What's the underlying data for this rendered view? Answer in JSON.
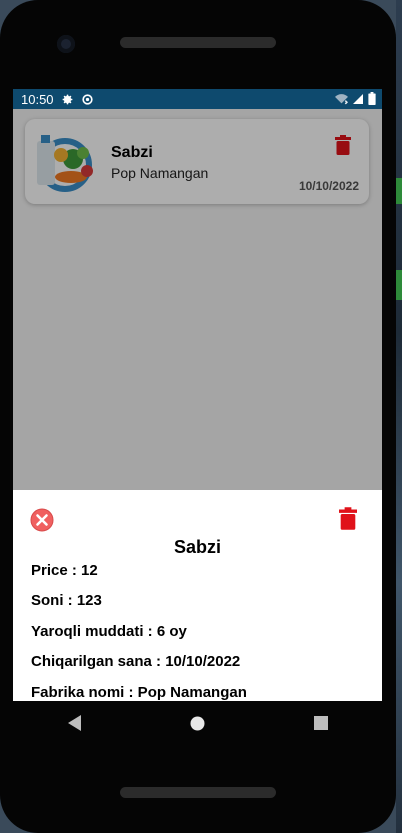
{
  "status": {
    "time": "10:50",
    "icons": [
      "gear-icon",
      "data-saver-icon",
      "wifi-icon",
      "signal-icon",
      "battery-icon"
    ]
  },
  "card": {
    "title": "Sabzi",
    "subtitle": "Pop Namangan",
    "date": "10/10/2022",
    "image": "vegetables-image",
    "trash_icon": "trash-icon"
  },
  "sheet": {
    "title": "Sabzi",
    "rows": {
      "price": "Price : 12",
      "soni": "Soni : 123",
      "muddati": "Yaroqli muddati : 6 oy",
      "sana": "Chiqarilgan sana : 10/10/2022",
      "fabrika": "Fabrika nomi : Pop Namangan"
    },
    "close_icon": "close-circle-icon",
    "trash_icon": "trash-icon"
  },
  "colors": {
    "status_bar": "#0e4a6e",
    "delete_red": "#e0121a",
    "close_red": "#f06060"
  },
  "nav": [
    "back-icon",
    "home-icon",
    "recents-icon"
  ]
}
